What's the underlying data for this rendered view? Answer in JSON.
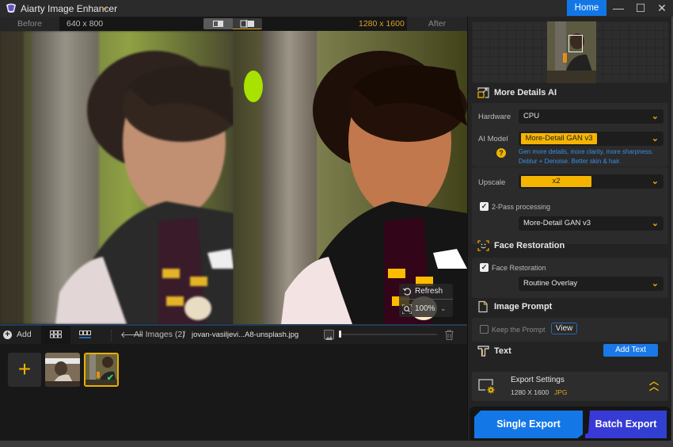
{
  "app": {
    "title": "Aiarty Image Enhancer",
    "home_label": "Home",
    "window_controls": {
      "minimize": "—",
      "maximize": "☐",
      "close": "✕"
    }
  },
  "compare": {
    "before_label": "Before",
    "before_resolution": "640 x 800",
    "after_resolution": "1280 x 1600",
    "after_label": "After",
    "view_modes": [
      "split-view",
      "side-by-side-view"
    ]
  },
  "overlay": {
    "refresh_label": "Refresh",
    "zoom_label": "100%"
  },
  "filmbar": {
    "add_label": "Add",
    "breadcrumb_all": "All Images (2)",
    "breadcrumb_sep": "/",
    "breadcrumb_file": "jovan-vasiljevi...A8-unsplash.jpg",
    "thumbnail_size_fraction": 0.02
  },
  "filmstrip": {
    "add_symbol": "+",
    "thumbnails": [
      {
        "name": "thumbnail-1",
        "selected": false,
        "processed": false
      },
      {
        "name": "thumbnail-2",
        "selected": true,
        "processed": true
      }
    ],
    "check_symbol": "✔"
  },
  "panel": {
    "more_details": {
      "title": "More Details AI",
      "hardware_label": "Hardware",
      "hardware_value": "CPU",
      "ai_model_label": "AI Model",
      "ai_model_value": "More-Detail GAN  v3",
      "ai_model_desc_1": "Gen more details, more clarity, more sharpness.",
      "ai_model_desc_2": "Deblur + Denoise. Better skin & hair.",
      "help_symbol": "?",
      "upscale_label": "Upscale",
      "upscale_value": "x2",
      "two_pass_label": "2-Pass processing",
      "two_pass_checked": true,
      "two_pass_model": "More-Detail GAN  v3"
    },
    "face_restoration": {
      "title": "Face Restoration",
      "checkbox_label": "Face Restoration",
      "checked": true,
      "mode_value": "Routine Overlay"
    },
    "image_prompt": {
      "title": "Image Prompt",
      "keep_label": "Keep the Prompt",
      "keep_checked": false,
      "view_label": "View"
    },
    "text": {
      "title": "Text",
      "add_label": "Add Text"
    },
    "export": {
      "title": "Export Settings",
      "resolution": "1280 X 1600",
      "format": "JPG",
      "single_label": "Single Export",
      "batch_label": "Batch Export"
    }
  },
  "colors": {
    "accent_yellow": "#f5b400",
    "primary_blue": "#1477e6",
    "batch_purple": "#3b38d8",
    "link_blue": "#3c8ee0"
  }
}
